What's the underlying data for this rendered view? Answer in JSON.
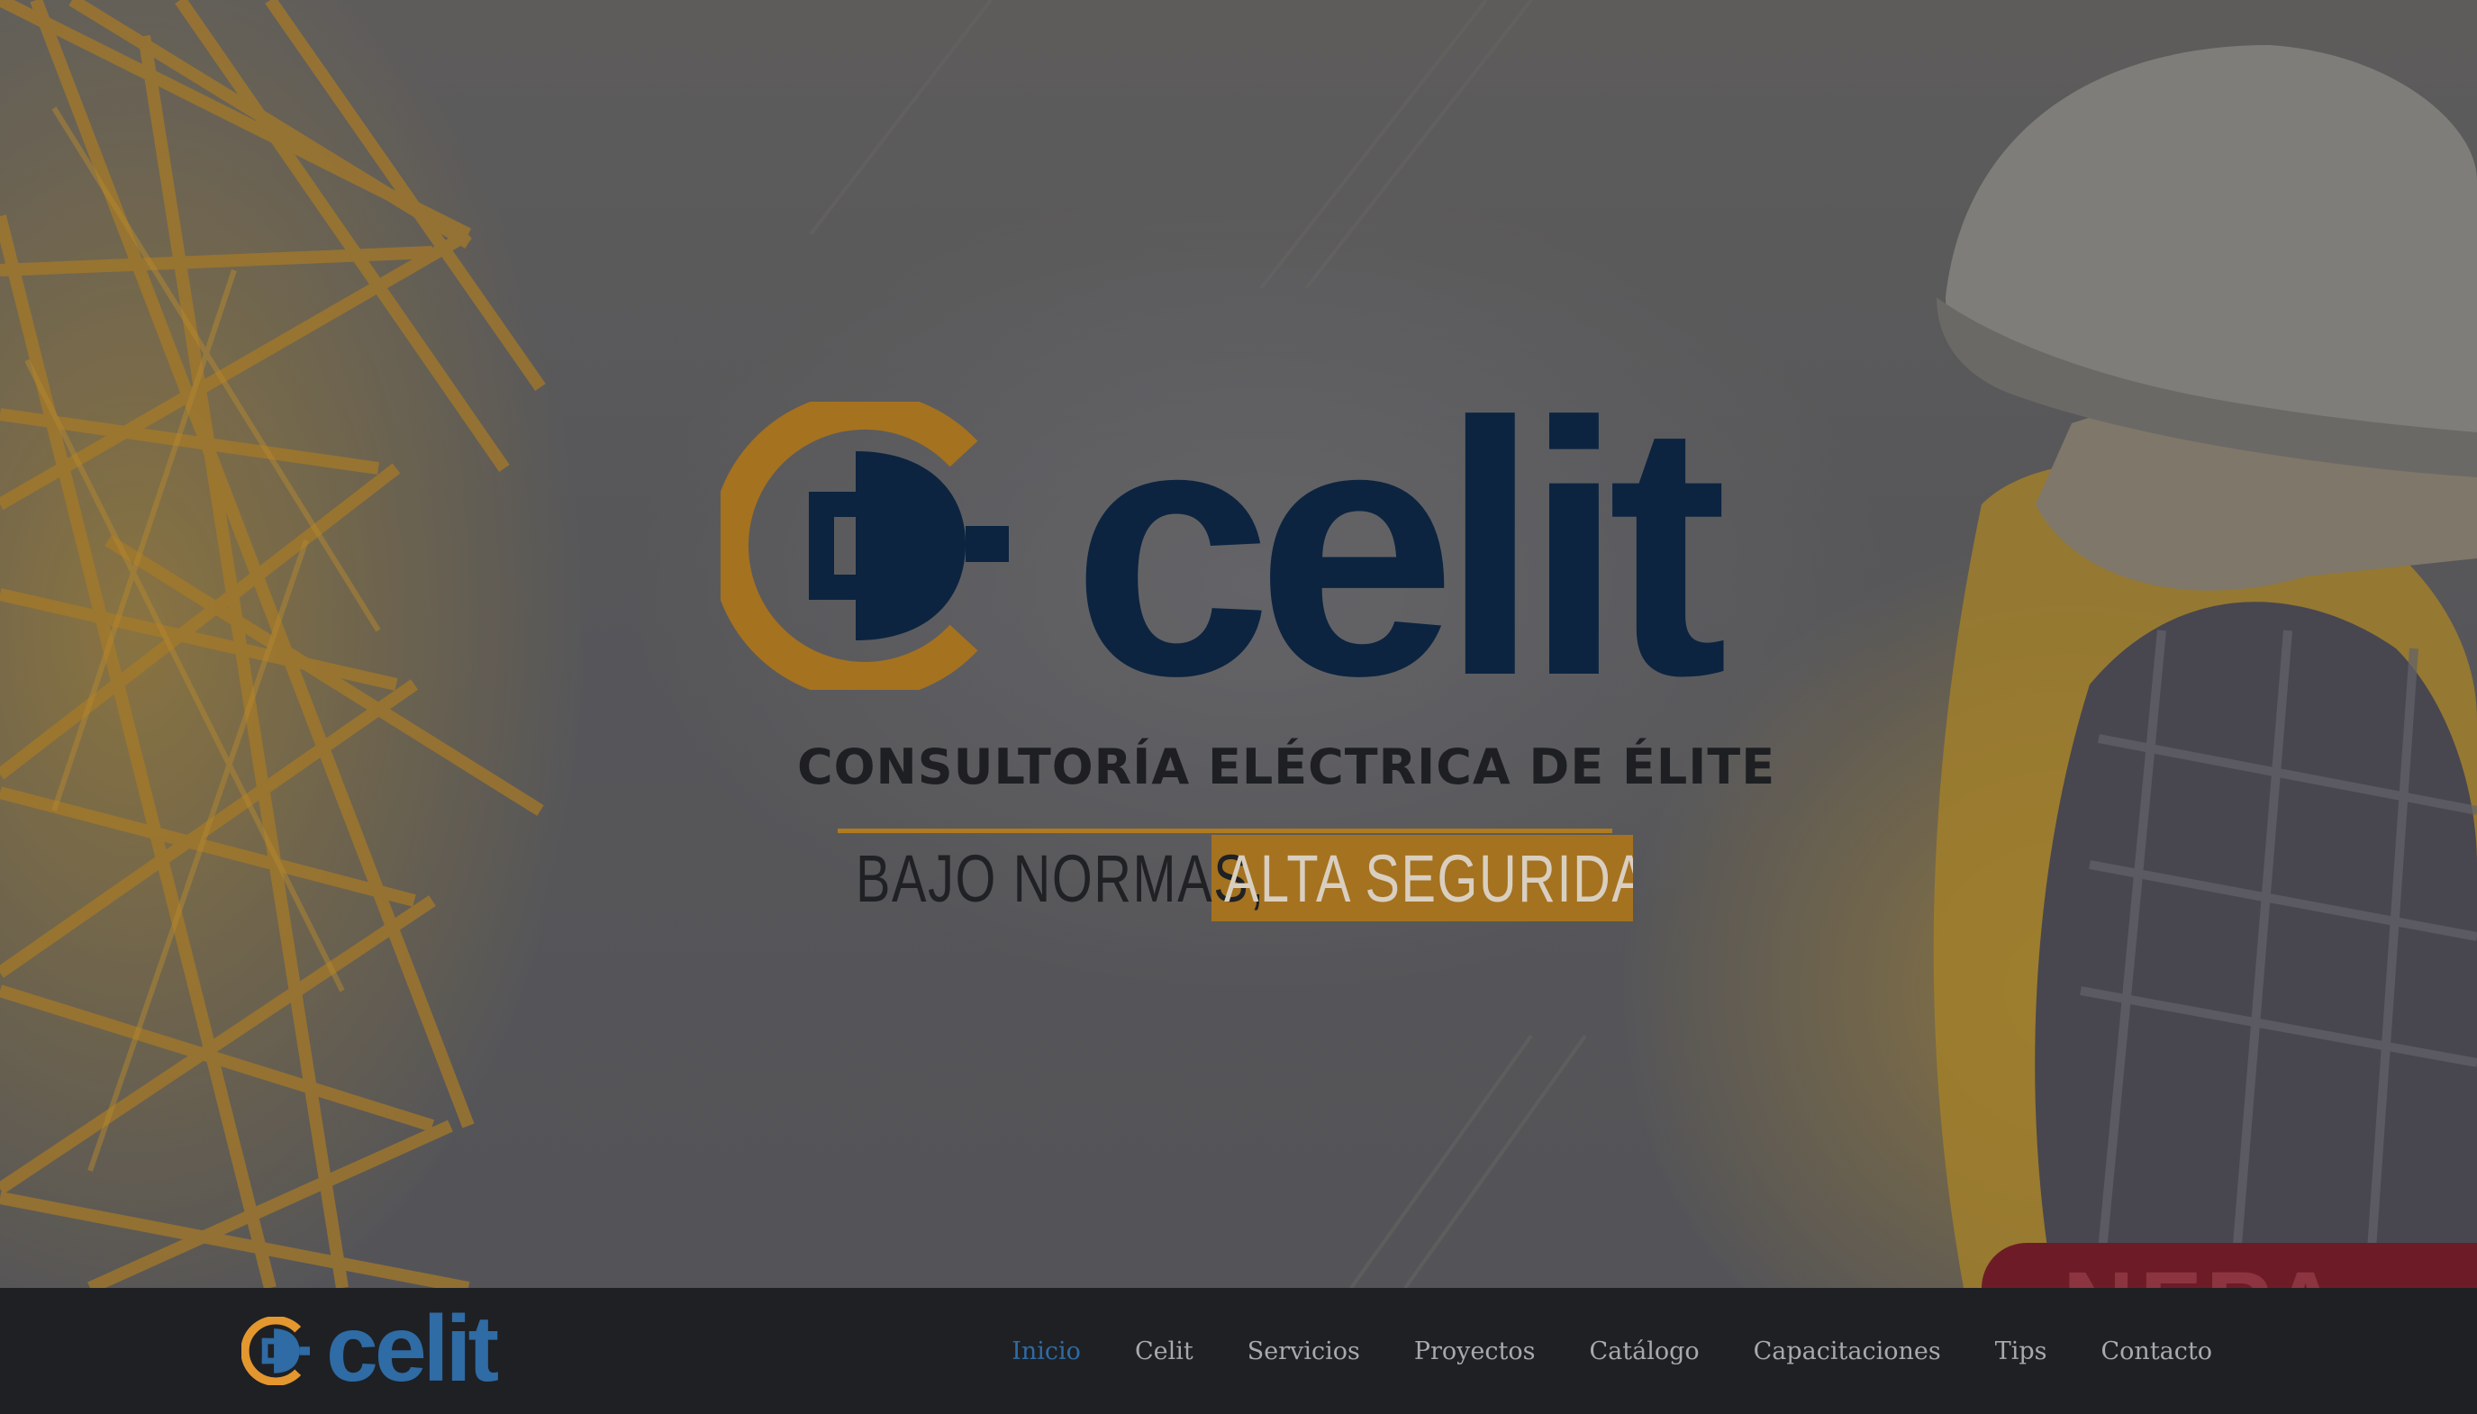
{
  "hero": {
    "logo": {
      "wordmark": "celit",
      "tagline": "CONSULTORÍA ELÉCTRICA DE ÉLITE",
      "slogan_part1": "BAJO NORMAS,",
      "slogan_part2": "ALTA SEGURIDAD"
    },
    "promo_text": "NFPA",
    "colors": {
      "logo_orange": "#a5721f",
      "logo_navy": "#0c2440",
      "promo_red": "#6d1c27"
    }
  },
  "navbar": {
    "brand_name": "celit",
    "items": [
      {
        "label": "Inicio",
        "active": true
      },
      {
        "label": "Celit",
        "active": false
      },
      {
        "label": "Servicios",
        "active": false
      },
      {
        "label": "Proyectos",
        "active": false
      },
      {
        "label": "Catálogo",
        "active": false
      },
      {
        "label": "Capacitaciones",
        "active": false
      },
      {
        "label": "Tips",
        "active": false
      },
      {
        "label": "Contacto",
        "active": false
      }
    ],
    "colors": {
      "background": "#1e2024",
      "active_link": "#2f6ba4",
      "link": "#a8a9ab",
      "brand_orange": "#e3972e"
    }
  }
}
